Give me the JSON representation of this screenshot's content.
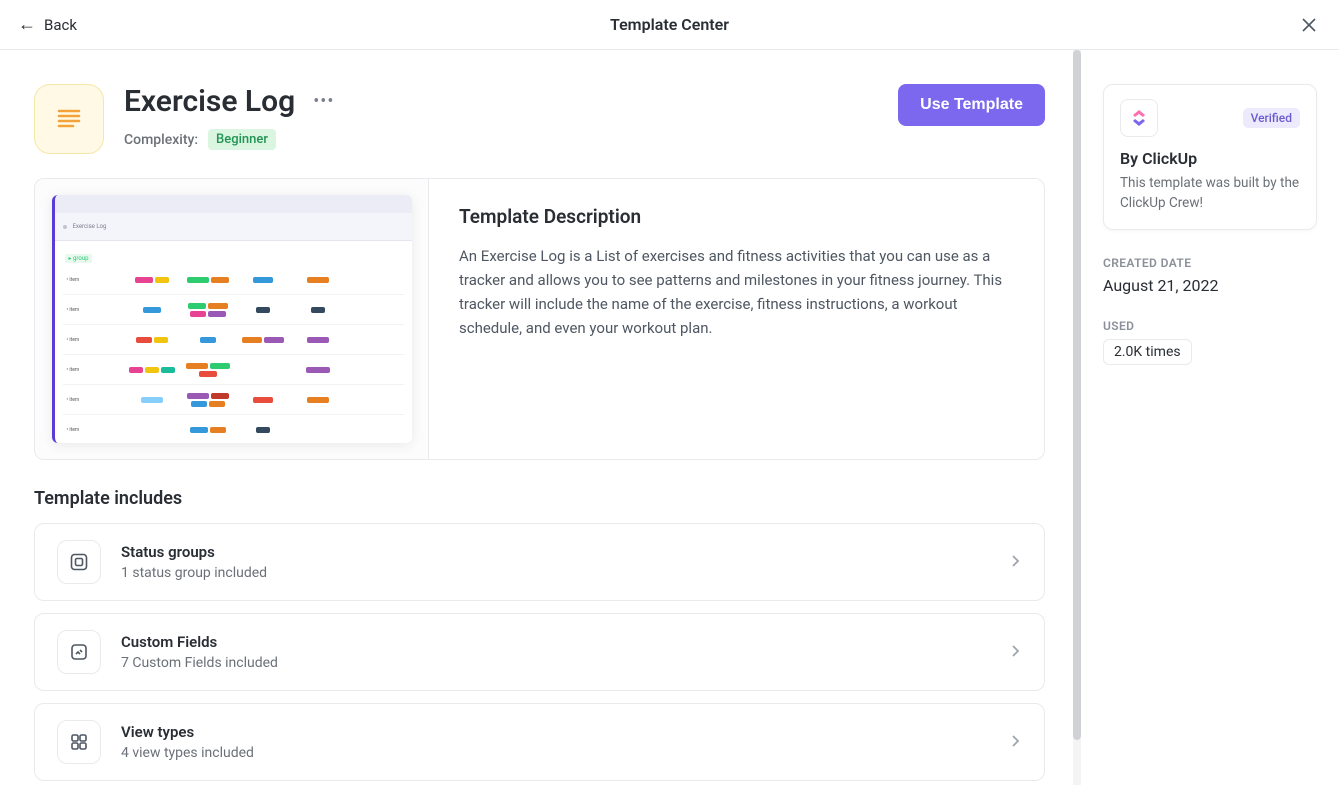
{
  "topbar": {
    "back_label": "Back",
    "title": "Template Center"
  },
  "template": {
    "title": "Exercise Log",
    "complexity_label": "Complexity:",
    "complexity_value": "Beginner",
    "use_button": "Use Template",
    "description_heading": "Template Description",
    "description_body": "An Exercise Log is a List of exercises and fitness activities that you can use as a tracker and allows you to see patterns and milestones in your fitness journey. This tracker will include the name of the exercise, fitness instructions, a workout schedule, and even your workout plan."
  },
  "includes": {
    "heading": "Template includes",
    "items": [
      {
        "title": "Status groups",
        "subtitle": "1 status group included"
      },
      {
        "title": "Custom Fields",
        "subtitle": "7 Custom Fields included"
      },
      {
        "title": "View types",
        "subtitle": "4 view types included"
      }
    ]
  },
  "sidebar": {
    "verified": "Verified",
    "author_name": "By ClickUp",
    "author_desc": "This template was built by the ClickUp Crew!",
    "created_label": "CREATED DATE",
    "created_value": "August 21, 2022",
    "used_label": "USED",
    "used_value": "2.0K times"
  }
}
